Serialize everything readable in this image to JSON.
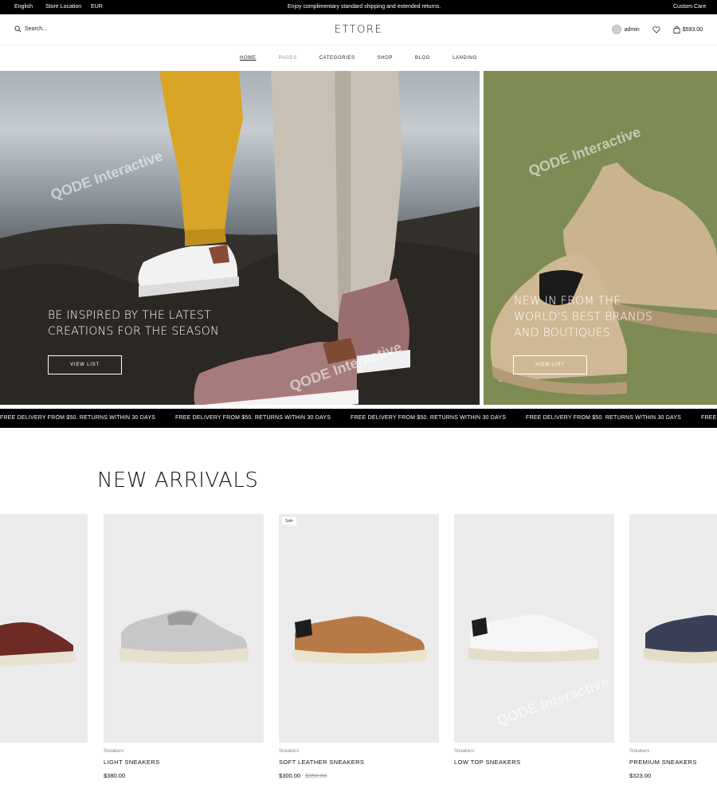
{
  "topbar": {
    "language": "English",
    "store_location": "Store Location",
    "currency": "EUR",
    "announcement": "Enjoy complimentary standard shipping and extended returns.",
    "custom_care": "Custom Care"
  },
  "header": {
    "search_placeholder": "Search...",
    "logo": "ETTORE",
    "user": "admin",
    "cart_total": "$593.00"
  },
  "nav": {
    "items": [
      "Home",
      "Pages",
      "Categories",
      "Shop",
      "Blog",
      "Landing"
    ]
  },
  "hero": {
    "left_title_1": "Be inspired by the latest",
    "left_title_2": "creations for the season",
    "left_button": "View List",
    "right_title_1": "New in from the",
    "right_title_2": "world's best brands",
    "right_title_3": "and boutiques",
    "right_button": "View List"
  },
  "marquee": {
    "text": "FREE DELIVERY FROM $50. RETURNS WITHIN 30 DAYS"
  },
  "arrivals": {
    "title": "NEW ARRIVALS",
    "products": [
      {
        "category": "Sneakers",
        "name": "Light Sneakers",
        "price": "$380.00",
        "old_price": "",
        "sale": ""
      },
      {
        "category": "Sneakers",
        "name": "Soft Leather Sneakers",
        "price": "$300.00",
        "old_price": "$350.00",
        "sale": "Sale"
      },
      {
        "category": "Sneakers",
        "name": "Low Top Sneakers",
        "price": "",
        "old_price": "",
        "sale": ""
      },
      {
        "category": "Sneakers",
        "name": "Premium Sneakers",
        "price": "$323.00",
        "old_price": "",
        "sale": ""
      }
    ]
  },
  "watermark": "QODE Interactive",
  "colors": {
    "topbar_bg": "#000000",
    "hero_right_bg": "#7d8a52",
    "card_bg": "#ebebeb"
  }
}
